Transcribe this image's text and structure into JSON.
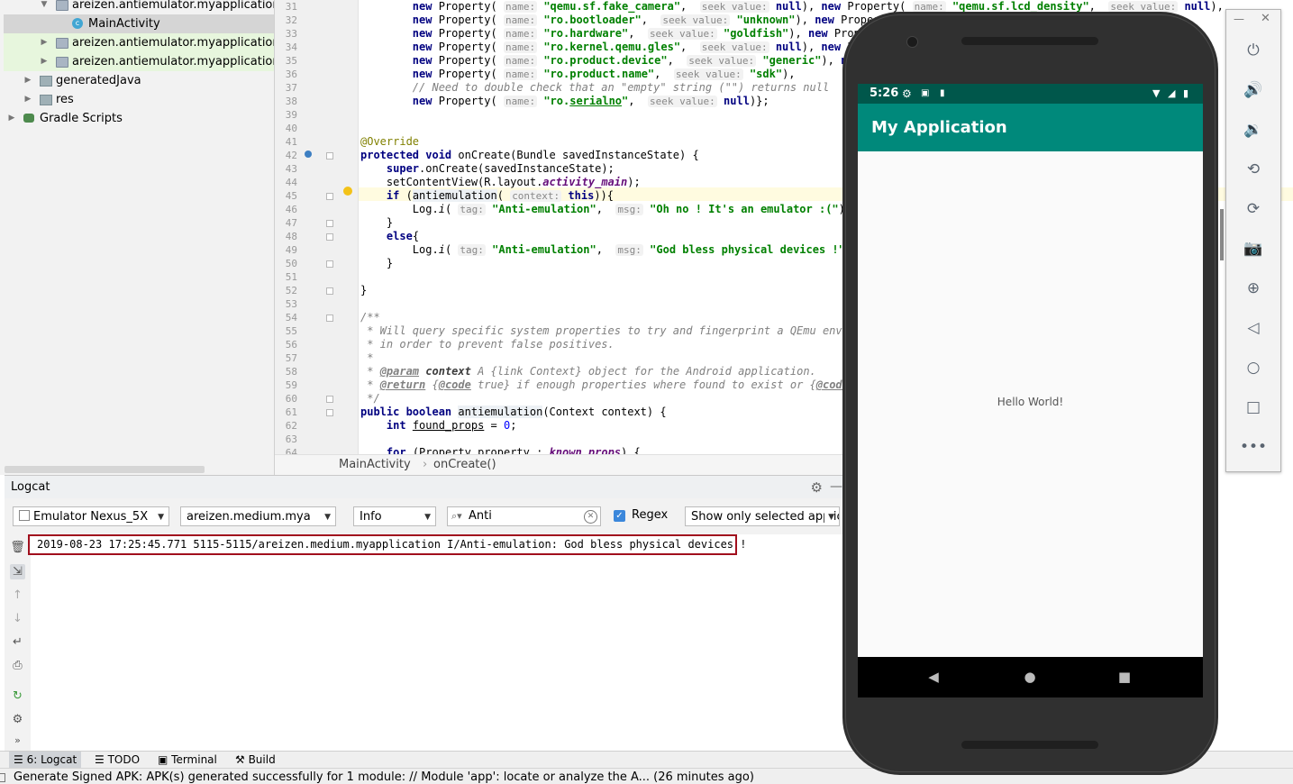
{
  "project_tree": {
    "items": [
      {
        "label": "areizen.antiemulator.myapplication"
      },
      {
        "label": "MainActivity"
      },
      {
        "label": "areizen.antiemulator.myapplication"
      },
      {
        "label": "areizen.antiemulator.myapplication"
      },
      {
        "label": "generatedJava"
      },
      {
        "label": "res"
      },
      {
        "label": "Gradle Scripts"
      }
    ]
  },
  "editor": {
    "line_numbers": [
      "31",
      "32",
      "33",
      "34",
      "35",
      "36",
      "37",
      "38",
      "39",
      "40",
      "41",
      "42",
      "43",
      "44",
      "45",
      "46",
      "47",
      "48",
      "49",
      "50",
      "51",
      "52",
      "53",
      "54",
      "55",
      "56",
      "57",
      "58",
      "59",
      "60",
      "61",
      "62",
      "63",
      "64"
    ]
  },
  "breadcrumb": {
    "file": "MainActivity",
    "method": "onCreate()"
  },
  "logcat": {
    "title": "Logcat",
    "device": "Emulator Nexus_5X",
    "process": "areizen.medium.mya",
    "process_bold": "mya",
    "level": "Info",
    "search": "Anti",
    "regex_label": "Regex",
    "filter": "Show only selected application",
    "log_line": "2019-08-23 17:25:45.771 5115-5115/areizen.medium.myapplication I/Anti-emulation: God bless physical devices !"
  },
  "tool_tabs": [
    {
      "label": "6: Logcat"
    },
    {
      "label": "TODO"
    },
    {
      "label": "Terminal"
    },
    {
      "label": "Build"
    }
  ],
  "status_bar": {
    "text": "Generate Signed APK: APK(s) generated successfully for 1 module: // Module 'app': locate or analyze the A... (26 minutes ago)"
  },
  "emulator": {
    "time": "5:26",
    "app_title": "My Application",
    "content": "Hello World!",
    "accent_color": "#00897b",
    "status_color": "#00574b"
  }
}
